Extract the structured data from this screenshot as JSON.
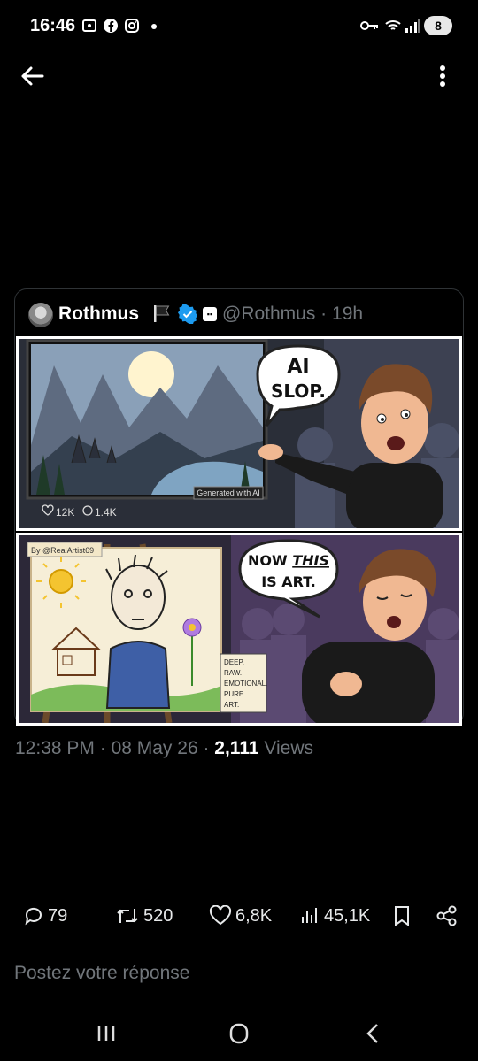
{
  "status_bar": {
    "time": "16:46",
    "battery": "8"
  },
  "quoted_tweet": {
    "name": "Rothmus",
    "handle_time": "@Rothmus · 19h"
  },
  "comic": {
    "panel1": {
      "speech": "AI\nSLOP.",
      "caption": "Generated with AI",
      "likes": "12K",
      "replies": "1.4K"
    },
    "panel2": {
      "signature": "By @RealArtist69",
      "speech_1": "NOW",
      "speech_this": "THIS",
      "speech_2": "IS ART.",
      "note": "DEEP.\nRAW.\nEMOTIONAL.\nPURE.\nART."
    }
  },
  "meta": {
    "time": "12:38 PM",
    "date": "08 May 26",
    "views_count": "2,111",
    "views_label": "Views"
  },
  "actions": {
    "replies": "79",
    "reposts": "520",
    "likes": "6,8K",
    "views": "45,1K"
  },
  "reply": {
    "placeholder": "Postez votre réponse"
  }
}
